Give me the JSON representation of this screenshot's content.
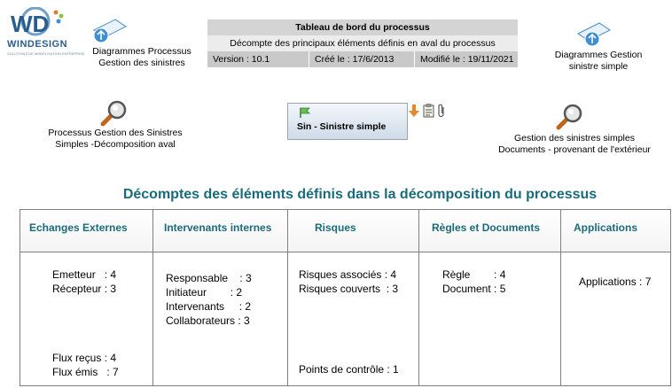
{
  "logo": {
    "text": "WINDESIGN",
    "tagline": "SOLUTIONS DE MODÉLISATION ENTREPRISE",
    "color": "#2a5d8f"
  },
  "links": {
    "left_diagram": [
      "Diagrammes Processus",
      "Gestion des sinistres"
    ],
    "right_diagram": [
      "Diagrammes Gestion",
      "sinistre simple"
    ],
    "left_process": [
      "Processus Gestion des Sinistres",
      "Simples -Décomposition aval"
    ],
    "right_process": [
      "Gestion des sinistres simples",
      "Documents - provenant de l'extérieur"
    ]
  },
  "header": {
    "title": "Tableau de bord du processus",
    "subtitle": "Décompte des principaux éléments définis en aval du processus",
    "version": "Version : 10.1",
    "created": "Créé le : 17/6/2013",
    "modified": "Modifié le : 19/11/2021"
  },
  "process": {
    "label": "Sin - Sinistre simple"
  },
  "main_title": "Décomptes des éléments définis dans la décomposition du processus",
  "table": {
    "headers": [
      "Echanges Externes",
      "Intervenants internes",
      "Risques",
      "Règles et Documents",
      "Applications"
    ],
    "echanges": {
      "emetteur": "Emetteur   : 4",
      "recepteur": "Récepteur : 3",
      "flux_recus": "Flux reçus : 4",
      "flux_emis": "Flux émis   : 7"
    },
    "intervenants": {
      "responsable": "Responsable    : 3",
      "initiateur": "Initiateur        : 2",
      "intervenants": "Intervenants     : 2",
      "collaborateurs": "Collaborateurs : 3"
    },
    "risques": {
      "associes": "Risques associés : 4",
      "couverts": "Risques couverts  : 3",
      "points": "Points de contrôle : 1"
    },
    "regles": {
      "regle": "Règle        : 4",
      "document": "Document : 5"
    },
    "applications": {
      "count": "Applications : 7"
    }
  },
  "colors": {
    "accent": "#1a6b7a"
  }
}
